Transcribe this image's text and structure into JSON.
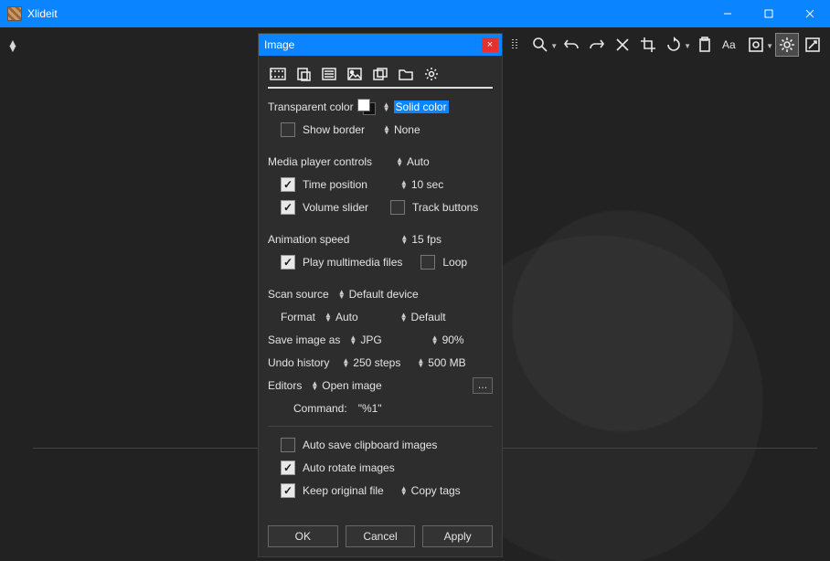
{
  "titlebar": {
    "app_name": "Xlideit"
  },
  "panel": {
    "title": "Image",
    "transparent_color_label": "Transparent color",
    "transparent_color_value": "Solid color",
    "show_border_label": "Show border",
    "show_border_value": "None",
    "media_controls_label": "Media player controls",
    "media_controls_value": "Auto",
    "time_position_label": "Time position",
    "time_position_value": "10 sec",
    "volume_slider_label": "Volume slider",
    "track_buttons_label": "Track buttons",
    "animation_speed_label": "Animation speed",
    "animation_speed_value": "15 fps",
    "play_multimedia_label": "Play multimedia files",
    "loop_label": "Loop",
    "scan_source_label": "Scan source",
    "scan_source_value": "Default device",
    "format_label": "Format",
    "format_value1": "Auto",
    "format_value2": "Default",
    "save_as_label": "Save image as",
    "save_as_value1": "JPG",
    "save_as_value2": "90%",
    "undo_label": "Undo history",
    "undo_value1": "250 steps",
    "undo_value2": "500 MB",
    "editors_label": "Editors",
    "editors_value": "Open image",
    "command_label": "Command:",
    "command_value": "\"%1\"",
    "auto_save_clip_label": "Auto save clipboard images",
    "auto_rotate_label": "Auto rotate images",
    "keep_original_label": "Keep original file",
    "copy_tags_value": "Copy tags",
    "ok_label": "OK",
    "cancel_label": "Cancel",
    "apply_label": "Apply"
  }
}
